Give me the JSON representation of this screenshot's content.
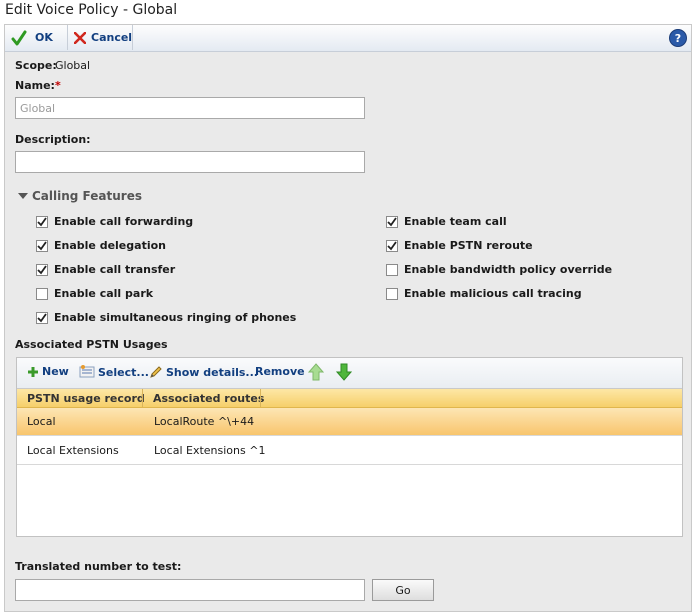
{
  "window": {
    "title": "Edit Voice Policy - Global"
  },
  "toolbar": {
    "ok_label": "OK",
    "cancel_label": "Cancel",
    "help_label": "?"
  },
  "form": {
    "scope_label": "Scope:",
    "scope_value": "Global",
    "name_label": "Name:",
    "name_required": "*",
    "name_value": "Global",
    "description_label": "Description:",
    "description_value": ""
  },
  "calling_features": {
    "title": "Calling Features",
    "left": [
      {
        "label": "Enable call forwarding",
        "checked": true
      },
      {
        "label": "Enable delegation",
        "checked": true
      },
      {
        "label": "Enable call transfer",
        "checked": true
      },
      {
        "label": "Enable call park",
        "checked": false
      },
      {
        "label": "Enable simultaneous ringing of phones",
        "checked": true
      }
    ],
    "right": [
      {
        "label": "Enable team call",
        "checked": true
      },
      {
        "label": "Enable PSTN reroute",
        "checked": true
      },
      {
        "label": "Enable bandwidth policy override",
        "checked": false
      },
      {
        "label": "Enable malicious call tracing",
        "checked": false
      }
    ]
  },
  "pstn": {
    "title": "Associated PSTN Usages",
    "toolbar": {
      "new_label": "New",
      "select_label": "Select...",
      "details_label": "Show details...",
      "remove_label": "Remove"
    },
    "columns": [
      "PSTN usage record",
      "Associated routes"
    ],
    "rows": [
      {
        "usage": "Local",
        "routes": "LocalRoute ^\\+44",
        "selected": true
      },
      {
        "usage": "Local Extensions",
        "routes": "Local Extensions ^1",
        "selected": false
      }
    ]
  },
  "test": {
    "label": "Translated number to test:",
    "value": "",
    "go_label": "Go"
  },
  "colors": {
    "accent": "#123f80",
    "selected_row": "#f8c56d",
    "required": "#c00000"
  }
}
